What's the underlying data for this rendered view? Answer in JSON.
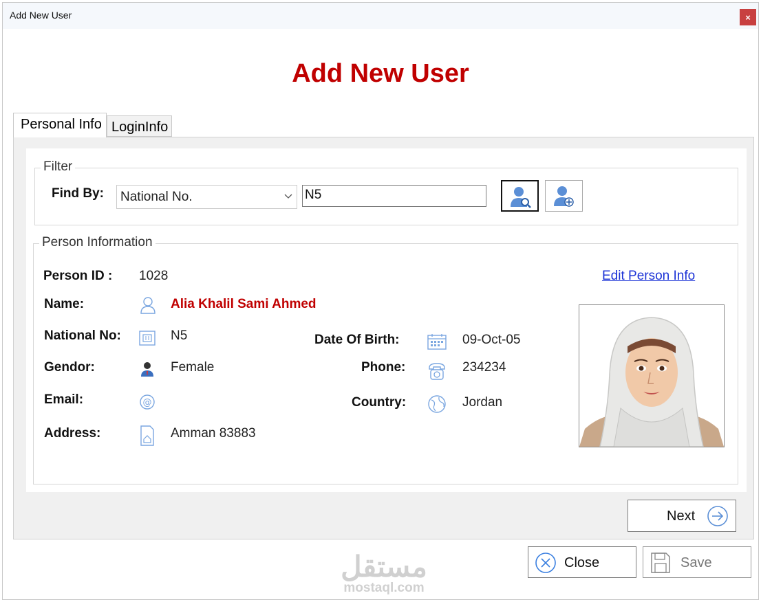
{
  "window": {
    "title": "Add New User",
    "close_label": "×"
  },
  "heading": "Add New User",
  "tabs": [
    {
      "label": "Personal Info",
      "active": true
    },
    {
      "label": "LoginInfo",
      "active": false
    }
  ],
  "filter": {
    "legend": "Filter",
    "find_by_label": "Find By:",
    "find_by_value": "National No.",
    "search_value": "N5"
  },
  "person": {
    "legend": "Person Information",
    "edit_link": "Edit Person Info",
    "fields": {
      "person_id": {
        "label": "Person ID :",
        "value": "1028"
      },
      "name": {
        "label": "Name:",
        "value": "Alia Khalil Sami Ahmed"
      },
      "national_no": {
        "label": "National No:",
        "value": "N5"
      },
      "gender": {
        "label": "Gendor:",
        "value": "Female"
      },
      "email": {
        "label": "Email:",
        "value": ""
      },
      "address": {
        "label": "Address:",
        "value": "Amman 83883"
      },
      "dob": {
        "label": "Date Of Birth:",
        "value": "09-Oct-05"
      },
      "phone": {
        "label": "Phone:",
        "value": "234234"
      },
      "country": {
        "label": "Country:",
        "value": "Jordan"
      }
    }
  },
  "buttons": {
    "next": "Next",
    "close": "Close",
    "save": "Save"
  },
  "watermark": {
    "arabic": "مستقل",
    "latin": "mostaql.com"
  },
  "colors": {
    "heading": "#c00000",
    "name_value": "#c00000",
    "link": "#1b32d6",
    "icon_blue": "#5b8fd6"
  }
}
